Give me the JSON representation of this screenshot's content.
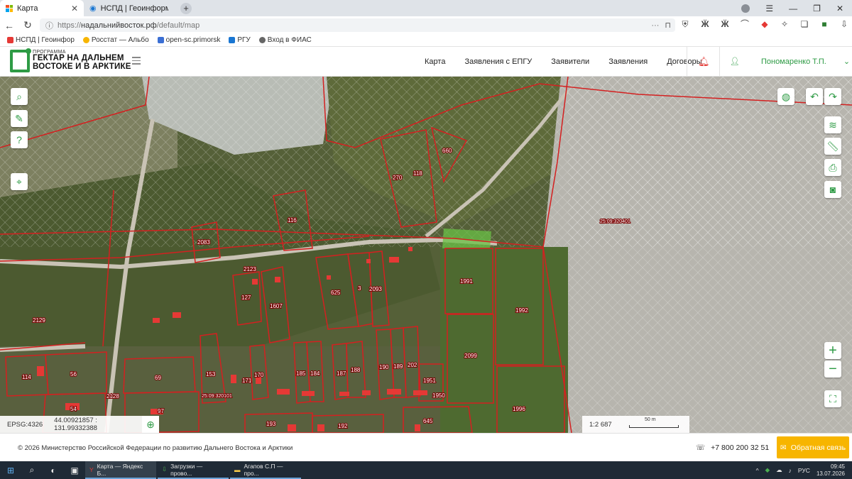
{
  "browser": {
    "tabs": [
      {
        "label": "Карта",
        "active": true
      },
      {
        "label": "НСПД | Геоинформацион",
        "active": false
      }
    ],
    "url_prefix": "https://",
    "url_host": "надальнийвосток.рф",
    "url_path": "/default/map",
    "bookmarks": [
      "НСПД | Геоинфор",
      "Росстат — Альбо",
      "open-sc.primorsk",
      "РГУ",
      "Вход в ФИАС"
    ]
  },
  "header": {
    "logo_small": "ПРОГРАММА",
    "logo_line1": "ГЕКТАР НА ДАЛЬНЕМ",
    "logo_line2": "ВОСТОКЕ И В АРКТИКЕ",
    "menu": [
      "Карта",
      "Заявления с ЕПГУ",
      "Заявители",
      "Заявления",
      "Договоры"
    ],
    "user_name": "Пономаренко Т.П."
  },
  "map": {
    "parcel_labels": [
      "660",
      "270",
      "118",
      "116",
      "2083",
      "2123",
      "625",
      "3",
      "2093",
      "127",
      "1607",
      "1991",
      "1992",
      "2129",
      "2099",
      "153",
      "170",
      "171",
      "185",
      "184",
      "187",
      "188",
      "190",
      "189",
      "202",
      "1951",
      "1950",
      "1996",
      "114",
      "56",
      "69",
      "54",
      "97",
      "2128",
      "193",
      "192",
      "645",
      "25:09:320101",
      "25:09:320401"
    ],
    "crs": "EPSG:4326",
    "coordinates": "44.00921857 : 131.99332388",
    "scale": "1:2 687",
    "scale_bar": "50 m"
  },
  "footer": {
    "copyright": "© 2026 Министерство Российской Федерации по развитию Дальнего Востока и Арктики",
    "phone": "+7 800 200 32 51",
    "feedback": "Обратная связь"
  },
  "taskbar": {
    "apps": [
      "Карта — Яндекс Б...",
      "Загрузки — прово...",
      "Агапов С.П — про..."
    ],
    "lang": "РУС",
    "time": "09:45",
    "date": "13.07.2026"
  },
  "colors": {
    "brand": "#2e9b45",
    "parcel": "#d42020",
    "feedback": "#f7b500"
  }
}
